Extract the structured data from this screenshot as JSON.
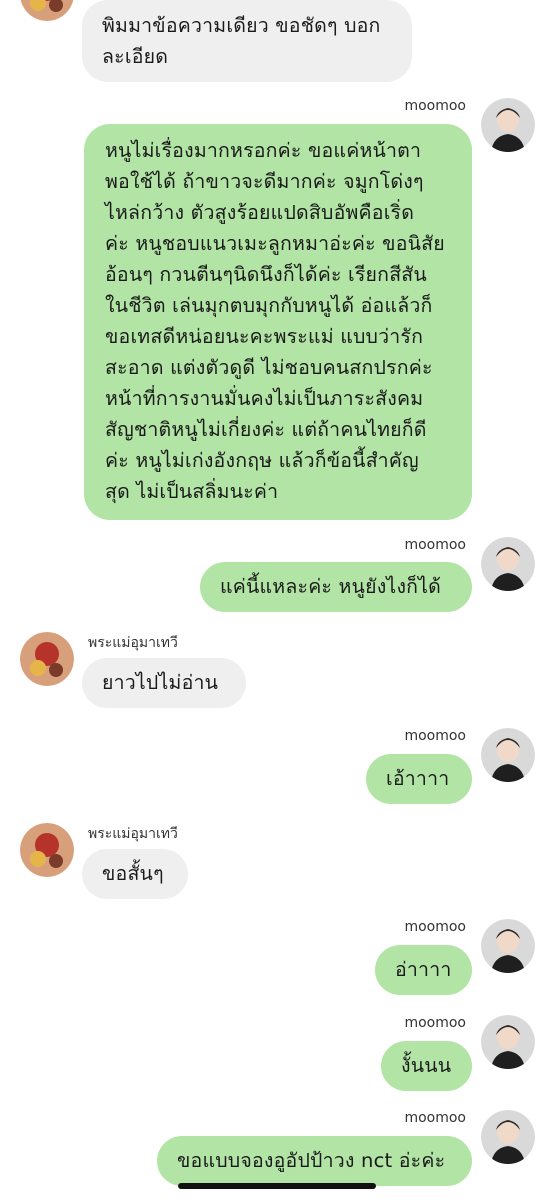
{
  "messages": [
    {
      "side": "in",
      "text": "พิมมาข้อความเดียว ขอชัดๆ บอกละเอียด"
    },
    {
      "side": "out",
      "sender": "moomoo",
      "text": "หนูไม่เรื่องมากหรอกค่ะ ขอแค่หน้าตาพอใช้ได้ ถ้าขาวจะดีมากค่ะ จมูกโด่งๆ ไหล่กว้าง ตัวสูงร้อยแปดสิบอัพคือเริ่ดค่ะ หนูชอบแนวเมะลูกหมาอ่ะค่ะ ขอนิสัยอ้อนๆ กวนตีนๆนิดนึงก็ได้ค่ะ เรียกสีสันในชีวิต เล่นมุกตบมุกกับหนูได้ อ่อแล้วก็ขอเทสดีหน่อยนะคะพระแม่ แบบว่ารักสะอาด แต่งตัวดูดี ไม่ชอบคนสกปรกค่ะ หน้าที่การงานมั่นคงไม่เป็นภาระสังคม สัญชาติหนูไม่เกี่ยงค่ะ แต่ถ้าคนไทยก็ดีค่ะ หนูไม่เก่งอังกฤษ แล้วก็ข้อนี้สำคัญสุด ไม่เป็นสลิ่มนะค่า"
    },
    {
      "side": "out",
      "sender": "moomoo",
      "text": "แค่นี้แหละค่ะ หนูยังไงก็ได้"
    },
    {
      "side": "in",
      "sender": "พระแม่อุมาเทวี",
      "text": "ยาวไปไม่อ่าน"
    },
    {
      "side": "out",
      "sender": "moomoo",
      "text": "เอ้าาาา"
    },
    {
      "side": "in",
      "sender": "พระแม่อุมาเทวี",
      "text": "ขอสั้นๆ"
    },
    {
      "side": "out",
      "sender": "moomoo",
      "text": "อ่าาาา"
    },
    {
      "side": "out",
      "sender": "moomoo",
      "text": "งั้นนน"
    },
    {
      "side": "out",
      "sender": "moomoo",
      "text": "ขอแบบจองอูอัปป้าวง nct อ่ะค่ะ"
    }
  ],
  "long_lines": [
    "หนูไม่เรื่องมากหรอกค่ะ ขอแค่หน้าตา",
    "พอใช้ได้ ถ้าขาวจะดีมากค่ะ จมูกโด่งๆ",
    "ไหล่กว้าง ตัวสูงร้อยแปดสิบอัพคือเริ่ด",
    "ค่ะ หนูชอบแนวเมะลูกหมาอ่ะค่ะ ขอนิสัย",
    "อ้อนๆ กวนตีนๆนิดนึงก็ได้ค่ะ เรียกสีสัน",
    "ในชีวิต เล่นมุกตบมุกกับหนูได้ อ่อแล้วก็",
    "ขอเทสดีหน่อยนะคะพระแม่ แบบว่ารัก",
    "สะอาด แต่งตัวดูดี ไม่ชอบคนสกปรกค่ะ",
    "หน้าที่การงานมั่นคงไม่เป็นภาระสังคม",
    "สัญชาติหนูไม่เกี่ยงค่ะ แต่ถ้าคนไทยก็ดี",
    "ค่ะ หนูไม่เก่งอังกฤษ แล้วก็ข้อนี้สำคัญ",
    "สุด ไม่เป็นสลิ่มนะค่า"
  ],
  "first_lines": [
    "พิมมาข้อความเดียว ขอชัดๆ บอก",
    "ละเอียด"
  ],
  "colors": {
    "outgoing_bubble": "#b2e4a5",
    "incoming_bubble": "#efefef",
    "background": "#ffffff"
  },
  "icons": {
    "outgoing_avatar": "user-portrait-avatar",
    "incoming_avatar": "deity-portrait-avatar"
  }
}
